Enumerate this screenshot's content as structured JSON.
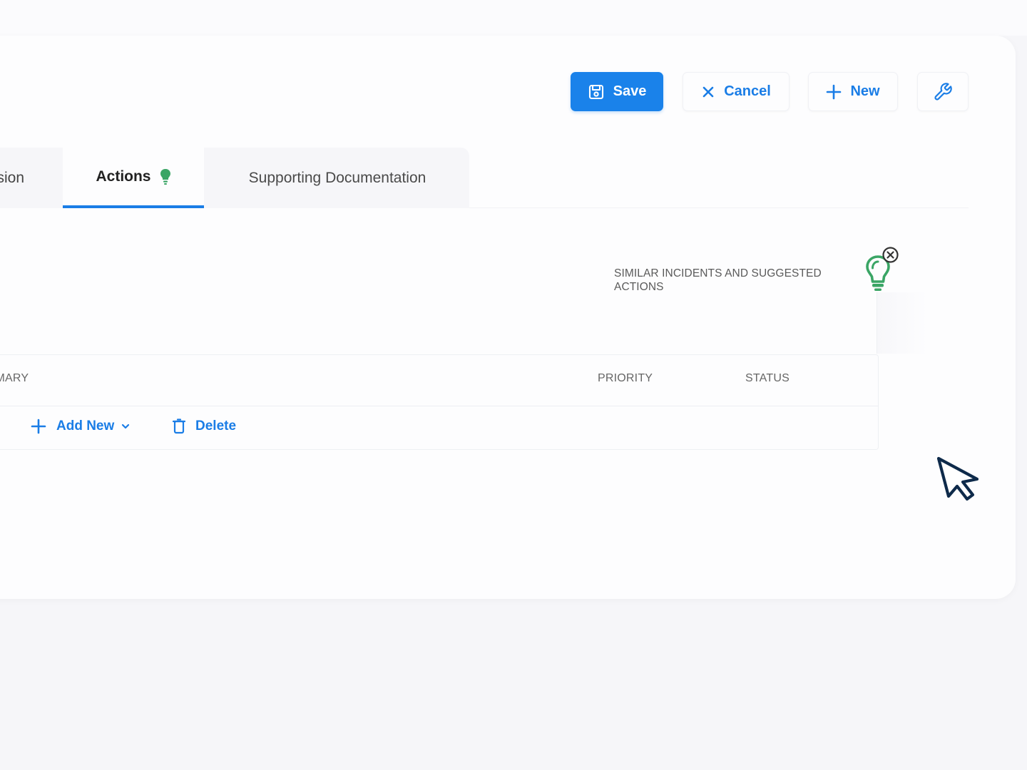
{
  "toolbar": {
    "save_label": "Save",
    "cancel_label": "Cancel",
    "new_label": "New",
    "save_icon": "save-disk-icon",
    "cancel_icon": "x-icon",
    "new_icon": "plus-icon",
    "tool_icon": "wrench-icon"
  },
  "tabs": [
    {
      "label": "sion",
      "active": false
    },
    {
      "label": "Actions",
      "active": true
    },
    {
      "label": "Supporting Documentation",
      "active": false
    }
  ],
  "similar": {
    "title": "SIMILAR INCIDENTS AND SUGGESTED ACTIONS",
    "icon": "lightbulb-icon"
  },
  "table": {
    "columns": [
      "MMARY",
      "PRIORITY",
      "STATUS"
    ],
    "actions": {
      "add_label": "Add New",
      "delete_label": "Delete"
    }
  },
  "colors": {
    "accent": "#1a82ea",
    "link": "#1a7de6",
    "bulb": "#3aa565",
    "cursor": "#0e2a4a"
  }
}
